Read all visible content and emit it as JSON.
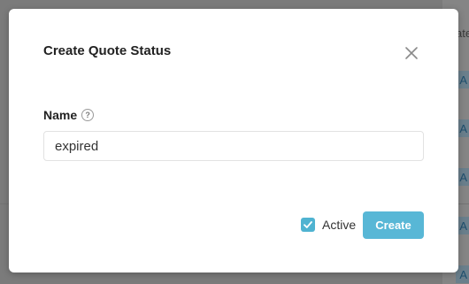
{
  "background": {
    "column_header_fragment": "ate",
    "cell_fragment": "A"
  },
  "modal": {
    "title": "Create Quote Status",
    "close_icon": "close-icon",
    "name_label": "Name",
    "help_icon": "help-icon",
    "name_value": "expired",
    "active_label": "Active",
    "active_checked": true,
    "create_label": "Create"
  },
  "colors": {
    "accent": "#58b7d6",
    "checkbox": "#4fb3d1",
    "overlay": "#7b7b7b"
  }
}
